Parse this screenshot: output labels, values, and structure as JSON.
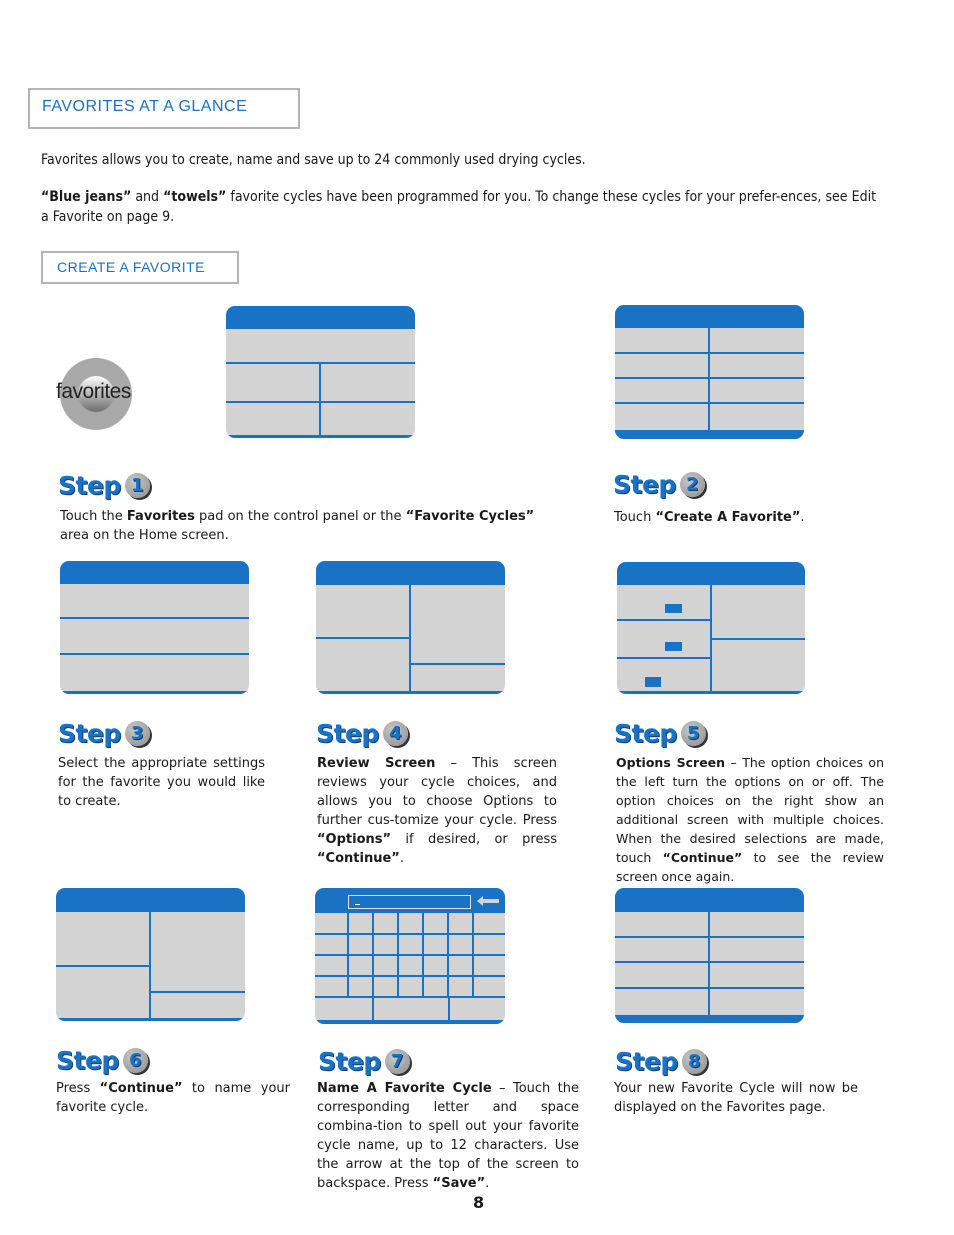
{
  "page": {
    "section_title": "Favorites at a Glance",
    "intro_1": "Favorites allows you to create, name and save up to 24 commonly used drying cycles.",
    "intro_2_bold_1": "“Blue jeans”",
    "intro_2_mid": " and ",
    "intro_2_bold_2": "“towels”",
    "intro_2_rest": " favorite cycles have been programmed for you.  To change these cycles for your prefer-ences, see Edit a Favorite on page 9.",
    "subsection_title": "Create a Favorite",
    "favorites_pad_label": "favorites",
    "page_number": "8"
  },
  "steps": [
    {
      "word": "Step",
      "num": "1",
      "parts": [
        [
          "",
          "Touch the "
        ],
        [
          "b",
          "Favorites"
        ],
        [
          "",
          " pad on the control panel or the "
        ],
        [
          "b",
          "“Favorite Cycles”"
        ],
        [
          "",
          " area on the Home screen."
        ]
      ]
    },
    {
      "word": "Step",
      "num": "2",
      "parts": [
        [
          "",
          "Touch "
        ],
        [
          "b",
          "“Create A Favorite”"
        ],
        [
          "",
          "."
        ]
      ]
    },
    {
      "word": "Step",
      "num": "3",
      "parts": [
        [
          "",
          "Select the appropriate settings for the favorite you would like to create."
        ]
      ]
    },
    {
      "word": "Step",
      "num": "4",
      "parts": [
        [
          "b",
          "Review Screen"
        ],
        [
          "",
          " – This screen reviews your cycle choices, and allows you to choose Options to further cus-tomize your cycle.  Press "
        ],
        [
          "b",
          "“Options”"
        ],
        [
          "",
          " if desired, or press "
        ],
        [
          "b",
          "“Continue”"
        ],
        [
          "",
          "."
        ]
      ]
    },
    {
      "word": "Step",
      "num": "5",
      "parts": [
        [
          "b",
          "Options Screen"
        ],
        [
          "",
          " – The option choices on the left turn the options on or off. The option choices on the right show an additional screen with multiple choices.  When the desired selections are made, touch "
        ],
        [
          "b",
          "“Continue”"
        ],
        [
          "",
          " to see the review screen once again."
        ]
      ]
    },
    {
      "word": "Step",
      "num": "6",
      "parts": [
        [
          "",
          "Press "
        ],
        [
          "b",
          "“Continue”"
        ],
        [
          "",
          " to name your favorite cycle."
        ]
      ]
    },
    {
      "word": "Step",
      "num": "7",
      "parts": [
        [
          "b",
          "Name A Favorite Cycle"
        ],
        [
          "",
          " – Touch the corresponding letter and space combina-tion to spell out your favorite cycle name, up to 12 characters.  Use the arrow at the top of the screen to backspace. Press "
        ],
        [
          "b",
          "“Save”"
        ],
        [
          "",
          "."
        ]
      ]
    },
    {
      "word": "Step",
      "num": "8",
      "parts": [
        [
          "",
          "Your new Favorite Cycle will now be displayed on the Favorites page."
        ]
      ]
    }
  ],
  "colors": {
    "accent_blue": "#1a72c4",
    "screen_gray": "#d3d3d3",
    "box_border": "#b4b4b4"
  }
}
